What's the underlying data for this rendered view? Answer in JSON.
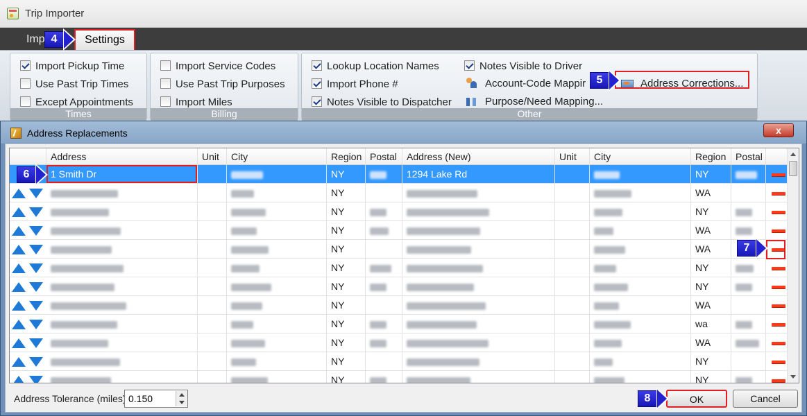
{
  "app": {
    "title": "Trip Importer"
  },
  "tabs": {
    "import_label": "Imp",
    "settings_label": "Settings"
  },
  "ribbon": {
    "times": {
      "label": "Times",
      "items": [
        {
          "label": "Import Pickup Time",
          "checked": true
        },
        {
          "label": "Use Past Trip Times",
          "checked": false
        },
        {
          "label": "Except Appointments",
          "checked": false
        }
      ]
    },
    "billing": {
      "label": "Billing",
      "items": [
        {
          "label": "Import Service Codes",
          "checked": false
        },
        {
          "label": "Use Past Trip Purposes",
          "checked": false
        },
        {
          "label": "Import Miles",
          "checked": false
        }
      ]
    },
    "other": {
      "label": "Other",
      "items": [
        {
          "label": "Lookup Location Names",
          "checked": true
        },
        {
          "label": "Import Phone #",
          "checked": true
        },
        {
          "label": "Notes Visible to Dispatcher",
          "checked": true
        },
        {
          "label": "Notes Visible to Driver",
          "checked": true
        }
      ],
      "buttons": {
        "account_code": "Account-Code Mappir",
        "purpose_need": "Purpose/Need Mapping...",
        "address_corrections": "Address Corrections..."
      }
    }
  },
  "dialog": {
    "title": "Address Replacements",
    "close_label": "x",
    "columns": [
      "Address",
      "Unit",
      "City",
      "Region",
      "Postal",
      "Address (New)",
      "Unit",
      "City",
      "Region",
      "Postal"
    ],
    "rows": [
      {
        "address": "1 Smith Dr",
        "region": "NY",
        "new_address": "1294 Lake Rd",
        "new_region": "NY",
        "selected": true
      },
      {
        "address": "",
        "region": "NY",
        "new_address": "",
        "new_region": "WA"
      },
      {
        "address": "",
        "region": "NY",
        "new_address": "",
        "new_region": "NY"
      },
      {
        "address": "",
        "region": "NY",
        "new_address": "",
        "new_region": "WA"
      },
      {
        "address": "",
        "region": "NY",
        "new_address": "",
        "new_region": "WA"
      },
      {
        "address": "",
        "region": "NY",
        "new_address": "",
        "new_region": "NY"
      },
      {
        "address": "",
        "region": "NY",
        "new_address": "",
        "new_region": "NY"
      },
      {
        "address": "",
        "region": "NY",
        "new_address": "",
        "new_region": "WA"
      },
      {
        "address": "",
        "region": "NY",
        "new_address": "",
        "new_region": "wa"
      },
      {
        "address": "",
        "region": "NY",
        "new_address": "",
        "new_region": "WA"
      },
      {
        "address": "",
        "region": "NY",
        "new_address": "",
        "new_region": "NY"
      },
      {
        "address": "",
        "region": "NY",
        "new_address": "",
        "new_region": "NY"
      }
    ],
    "tolerance_label": "Address Tolerance (miles):",
    "tolerance_value": "0.150",
    "ok_label": "OK",
    "cancel_label": "Cancel"
  },
  "callouts": [
    "4",
    "5",
    "6",
    "7",
    "8"
  ],
  "colors": {
    "highlight": "#e02020",
    "callout": "#2222d0",
    "selection": "#3399ff",
    "remove_button": "#ff3a1a",
    "move_arrow": "#1e7ad6"
  }
}
